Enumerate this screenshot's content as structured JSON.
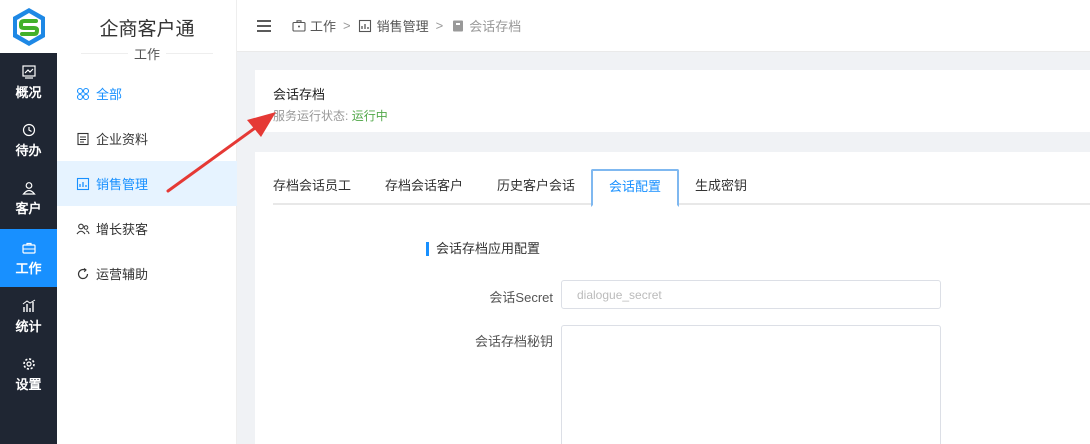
{
  "app": {
    "title": "企商客户通",
    "subtitle": "工作",
    "logo_icon": "s-logo-icon"
  },
  "rail": [
    {
      "label": "概况",
      "icon": "overview-chart-icon"
    },
    {
      "label": "待办",
      "icon": "clock-icon"
    },
    {
      "label": "客户",
      "icon": "user-icon"
    },
    {
      "label": "工作",
      "icon": "briefcase-icon",
      "active": true
    },
    {
      "label": "统计",
      "icon": "bar-chart-icon"
    },
    {
      "label": "设置",
      "icon": "gear-icon"
    }
  ],
  "submenu": [
    {
      "label": "全部",
      "icon": "grid-icon"
    },
    {
      "label": "企业资料",
      "icon": "document-icon"
    },
    {
      "label": "销售管理",
      "icon": "sales-chart-icon",
      "active": true
    },
    {
      "label": "增长获客",
      "icon": "users-icon"
    },
    {
      "label": "运营辅助",
      "icon": "refresh-icon"
    }
  ],
  "breadcrumb": {
    "items": [
      "工作",
      "销售管理",
      "会话存档"
    ],
    "separator": ">"
  },
  "header": {
    "title": "会话存档",
    "status_label": "服务运行状态:",
    "status_value": "运行中"
  },
  "tabs": [
    "存档会话员工",
    "存档会话客户",
    "历史客户会话",
    "会话配置",
    "生成密钥"
  ],
  "form": {
    "section_title": "会话存档应用配置",
    "secret_label": "会话Secret",
    "secret_placeholder": "dialogue_secret",
    "key_label": "会话存档秘钥"
  },
  "colors": {
    "accent": "#1890ff",
    "rail_bg": "#1f2633",
    "status_ok": "#52a84a",
    "annotation_arrow": "#e53935"
  }
}
